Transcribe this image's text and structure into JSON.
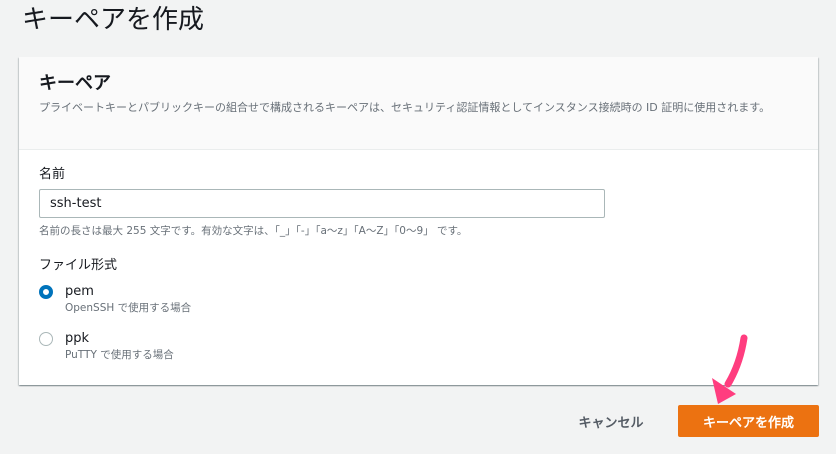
{
  "page": {
    "title": "キーペアを作成"
  },
  "panel": {
    "title": "キーペア",
    "description": "プライベートキーとパブリックキーの組合せで構成されるキーペアは、セキュリティ認証情報としてインスタンス接続時の ID 証明に使用されます。"
  },
  "name_field": {
    "label": "名前",
    "value": "ssh-test",
    "constraint": "名前の長さは最大 255 文字です。有効な文字は、「_」「-」「a〜z」「A〜Z」「0〜9」 です。"
  },
  "file_format": {
    "label": "ファイル形式",
    "options": [
      {
        "title": "pem",
        "subtitle": "OpenSSH で使用する場合",
        "selected": true
      },
      {
        "title": "ppk",
        "subtitle": "PuTTY で使用する場合",
        "selected": false
      }
    ]
  },
  "actions": {
    "cancel_label": "キャンセル",
    "create_label": "キーペアを作成"
  },
  "colors": {
    "primary_button": "#ec7211",
    "radio_selected": "#0073bb",
    "annotation_arrow": "#ff3d7f"
  }
}
